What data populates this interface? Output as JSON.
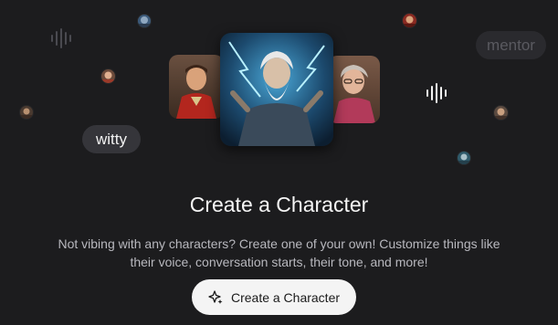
{
  "hero": {
    "chips": {
      "witty": "witty",
      "mentor": "mentor"
    },
    "cards": {
      "left": "character-portrait",
      "center": "character-portrait",
      "right": "character-portrait"
    }
  },
  "main": {
    "title": "Create a Character",
    "description": "Not vibing with any characters? Create one of your own! Customize things like their voice, conversation starts, their tone, and more!",
    "cta_label": "Create a Character",
    "cta_icon": "sparkle-icon"
  },
  "colors": {
    "background": "#1c1c1e",
    "cta_background": "#f4f4f4",
    "chip_background": "#35353a"
  }
}
